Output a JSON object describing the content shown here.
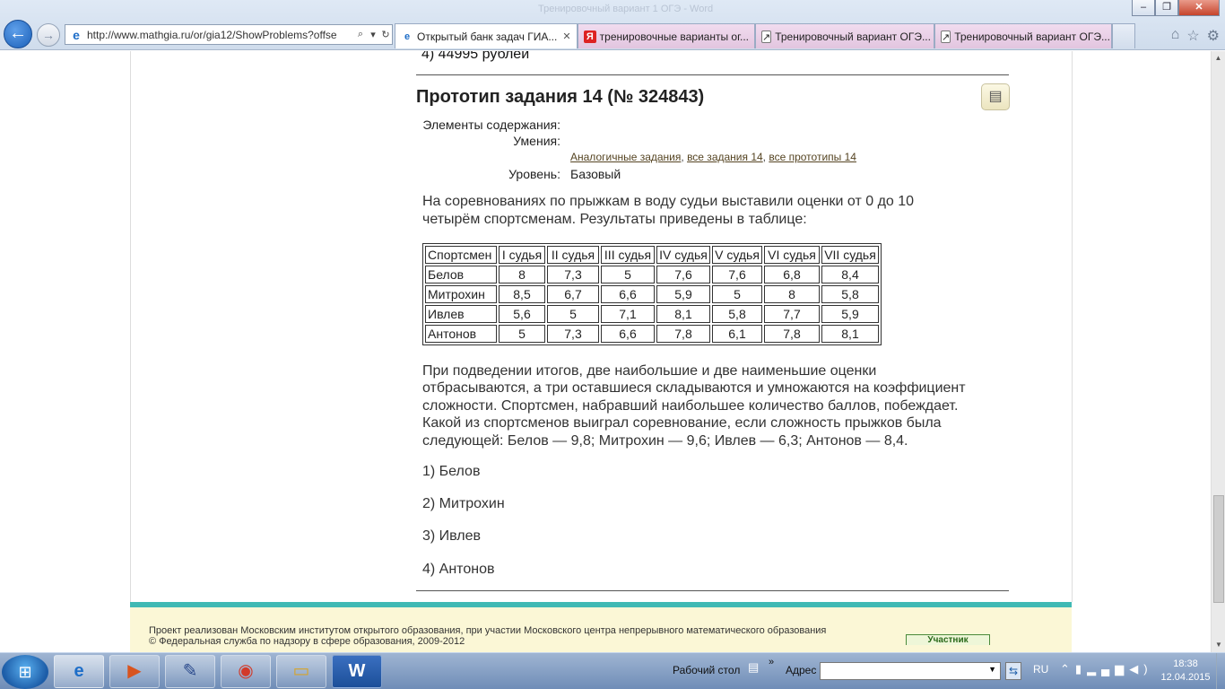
{
  "browser": {
    "faded_title": "Тренировочный вариант 1 ОГЭ - Word",
    "url": "http://www.mathgia.ru/or/gia12/ShowProblems?offse",
    "tabs": [
      {
        "label": "Открытый банк задач ГИА...",
        "icon": "ie-icon",
        "active": true
      },
      {
        "label": "тренировочные варианты ог...",
        "icon": "yandex-icon",
        "active": false
      },
      {
        "label": "Тренировочный вариант ОГЭ...",
        "icon": "page-icon",
        "active": false
      },
      {
        "label": "Тренировочный вариант ОГЭ...",
        "icon": "page-icon",
        "active": false
      }
    ]
  },
  "page": {
    "prev_answer": "4) 44995 рублей",
    "prototype_title": "Прототип задания 14 (№ 324843)",
    "meta": {
      "elements_label": "Элементы содержания:",
      "skills_label": "Умения:",
      "links": [
        "Аналогичные задания",
        "все задания 14",
        "все прототипы 14"
      ],
      "level_label": "Уровень:",
      "level_value": "Базовый"
    },
    "intro_line1": "На соревнованиях по прыжкам в воду судьи выставили оценки от 0 до 10",
    "intro_line2": "четырём спортсменам. Результаты приведены в таблице:",
    "table": {
      "headers": [
        "Спортсмен",
        "I судья",
        "II судья",
        "III судья",
        "IV судья",
        "V судья",
        "VI судья",
        "VII судья"
      ],
      "rows": [
        [
          "Белов",
          "8",
          "7,3",
          "5",
          "7,6",
          "7,6",
          "6,8",
          "8,4"
        ],
        [
          "Митрохин",
          "8,5",
          "6,7",
          "6,6",
          "5,9",
          "5",
          "8",
          "5,8"
        ],
        [
          "Ивлев",
          "5,6",
          "5",
          "7,1",
          "8,1",
          "5,8",
          "7,7",
          "5,9"
        ],
        [
          "Антонов",
          "5",
          "7,3",
          "6,6",
          "7,8",
          "6,1",
          "7,8",
          "8,1"
        ]
      ]
    },
    "rules_lines": [
      "При подведении итогов, две наибольшие и две наименьшие оценки",
      "отбрасываются, а три оставшиеся складываются и умножаются на коэффициент",
      "сложности. Спортсмен, набравший наибольшее количество баллов, побеждает.",
      "Какой из спортсменов выиграл соревнование, если сложность прыжков была",
      "следующей: Белов — 9,8; Митрохин — 9,6; Ивлев — 6,3; Антонов — 8,4."
    ],
    "options": [
      "1) Белов",
      "2) Митрохин",
      "3) Ивлев",
      "4) Антонов"
    ],
    "footer": {
      "line1": "Проект реализован Московским институтом открытого образования, при участии Московского центра непрерывного математического образования",
      "line2": "© Федеральная служба по надзору в сфере образования, 2009-2012",
      "badge": "Участник"
    }
  },
  "taskbar": {
    "desktop_label": "Рабочий стол",
    "address_label": "Адрес",
    "lang": "RU",
    "time": "18:38",
    "date": "12.04.2015"
  }
}
